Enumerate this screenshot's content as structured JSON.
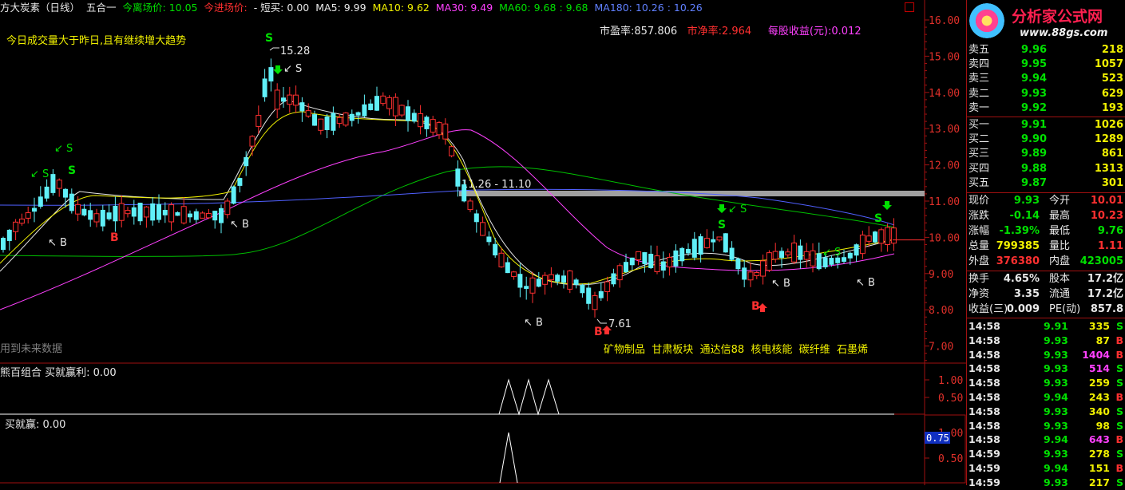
{
  "header": {
    "stock_name": "方大炭素（日线）",
    "formula": "五合一",
    "exit_price_label": "今离场价:",
    "exit_price": "10.05",
    "entry_price_label": "今进场价:",
    "short_buy_label": "- 短买:",
    "short_buy": "0.00",
    "ma5_label": "MA5:",
    "ma5": "9.99",
    "ma10_label": "MA10:",
    "ma10": "9.62",
    "ma30_label": "MA30:",
    "ma30": "9.49",
    "ma60_label": "MA60:",
    "ma60": "9.68",
    "ma60b": "9.68",
    "ma180_label": "MA180:",
    "ma180": "10.26",
    "ma180b": "10.26",
    "colon": ":"
  },
  "notes": {
    "volume_note": "今日成交量大于昨日,且有继续增大趋势",
    "future_data": "用到未来数据"
  },
  "fundamentals": {
    "pe_label": "市盈率:",
    "pe": "857.806",
    "pb_label": "市净率:",
    "pb": "2.964",
    "eps_label": "每股收益(元):",
    "eps": "0.012"
  },
  "concepts": [
    "矿物制品",
    "甘肃板块",
    "通达信88",
    "核电核能",
    "碳纤维",
    "石墨烯"
  ],
  "annotations": {
    "high": "15.28",
    "low": "7.61",
    "range": "11.26 - 11.10",
    "sell_sign": "S",
    "buy_sign": "B",
    "sell_arrow": "↙ S",
    "buy_arrow": "↖ B"
  },
  "price_axis": [
    "16.00",
    "15.00",
    "14.00",
    "13.00",
    "12.00",
    "11.00",
    "10.00",
    "9.00",
    "8.00",
    "7.00"
  ],
  "sub1": {
    "title": "熊百组合  买就赢利: 0.00",
    "ticks": [
      "1.00",
      "0.50"
    ]
  },
  "sub2": {
    "title": "买就赢: 0.00",
    "ticks": [
      "1.00",
      "0.50"
    ],
    "cursor": "0.75"
  },
  "logo": {
    "text": "分析家公式网",
    "url": "www.88gs.com"
  },
  "order_book": {
    "sell": [
      {
        "label": "卖五",
        "price": "9.96",
        "vol": "218"
      },
      {
        "label": "卖四",
        "price": "9.95",
        "vol": "1057"
      },
      {
        "label": "卖三",
        "price": "9.94",
        "vol": "523"
      },
      {
        "label": "卖二",
        "price": "9.93",
        "vol": "629"
      },
      {
        "label": "卖一",
        "price": "9.92",
        "vol": "193"
      }
    ],
    "buy": [
      {
        "label": "买一",
        "price": "9.91",
        "vol": "1026"
      },
      {
        "label": "买二",
        "price": "9.90",
        "vol": "1289"
      },
      {
        "label": "买三",
        "price": "9.89",
        "vol": "861"
      },
      {
        "label": "买四",
        "price": "9.88",
        "vol": "1313"
      },
      {
        "label": "买五",
        "price": "9.87",
        "vol": "301"
      }
    ]
  },
  "stats": [
    {
      "l1": "现价",
      "v1": "9.93",
      "c1": "#00e000",
      "l2": "今开",
      "v2": "10.01",
      "c2": "#ff3030"
    },
    {
      "l1": "涨跌",
      "v1": "-0.14",
      "c1": "#00e000",
      "l2": "最高",
      "v2": "10.23",
      "c2": "#ff3030"
    },
    {
      "l1": "涨幅",
      "v1": "-1.39%",
      "c1": "#00e000",
      "l2": "最低",
      "v2": "9.76",
      "c2": "#00e000"
    },
    {
      "l1": "总量",
      "v1": "799385",
      "c1": "#f0f000",
      "l2": "量比",
      "v2": "1.11",
      "c2": "#ff3030"
    },
    {
      "l1": "外盘",
      "v1": "376380",
      "c1": "#ff3030",
      "l2": "内盘",
      "v2": "423005",
      "c2": "#00e000"
    }
  ],
  "stats2": [
    {
      "l1": "换手",
      "v1": "4.65%",
      "c1": "#e8e8e8",
      "l2": "股本",
      "v2": "17.2亿",
      "c2": "#e8e8e8"
    },
    {
      "l1": "净资",
      "v1": "3.35",
      "c1": "#e8e8e8",
      "l2": "流通",
      "v2": "17.2亿",
      "c2": "#e8e8e8"
    },
    {
      "l1": "收益(三)",
      "v1": "0.009",
      "c1": "#e8e8e8",
      "l2": "PE(动)",
      "v2": "857.8",
      "c2": "#e8e8e8"
    }
  ],
  "ticks": [
    {
      "t": "14:58",
      "p": "9.91",
      "v": "335",
      "vc": "#f0f000",
      "s": "S",
      "sc": "#00e000"
    },
    {
      "t": "14:58",
      "p": "9.93",
      "v": "87",
      "vc": "#f0f000",
      "s": "B",
      "sc": "#ff3030"
    },
    {
      "t": "14:58",
      "p": "9.93",
      "v": "1404",
      "vc": "#ff40ff",
      "s": "B",
      "sc": "#ff3030"
    },
    {
      "t": "14:58",
      "p": "9.93",
      "v": "514",
      "vc": "#ff40ff",
      "s": "S",
      "sc": "#00e000"
    },
    {
      "t": "14:58",
      "p": "9.93",
      "v": "259",
      "vc": "#f0f000",
      "s": "S",
      "sc": "#00e000"
    },
    {
      "t": "14:58",
      "p": "9.94",
      "v": "243",
      "vc": "#f0f000",
      "s": "B",
      "sc": "#ff3030"
    },
    {
      "t": "14:58",
      "p": "9.93",
      "v": "340",
      "vc": "#f0f000",
      "s": "S",
      "sc": "#00e000"
    },
    {
      "t": "14:58",
      "p": "9.93",
      "v": "98",
      "vc": "#f0f000",
      "s": "S",
      "sc": "#00e000"
    },
    {
      "t": "14:58",
      "p": "9.94",
      "v": "643",
      "vc": "#ff40ff",
      "s": "B",
      "sc": "#ff3030"
    },
    {
      "t": "14:59",
      "p": "9.93",
      "v": "278",
      "vc": "#f0f000",
      "s": "S",
      "sc": "#00e000"
    },
    {
      "t": "14:59",
      "p": "9.94",
      "v": "151",
      "vc": "#f0f000",
      "s": "B",
      "sc": "#ff3030"
    },
    {
      "t": "14:59",
      "p": "9.93",
      "v": "217",
      "vc": "#f0f000",
      "s": "S",
      "sc": "#00e000"
    }
  ]
}
